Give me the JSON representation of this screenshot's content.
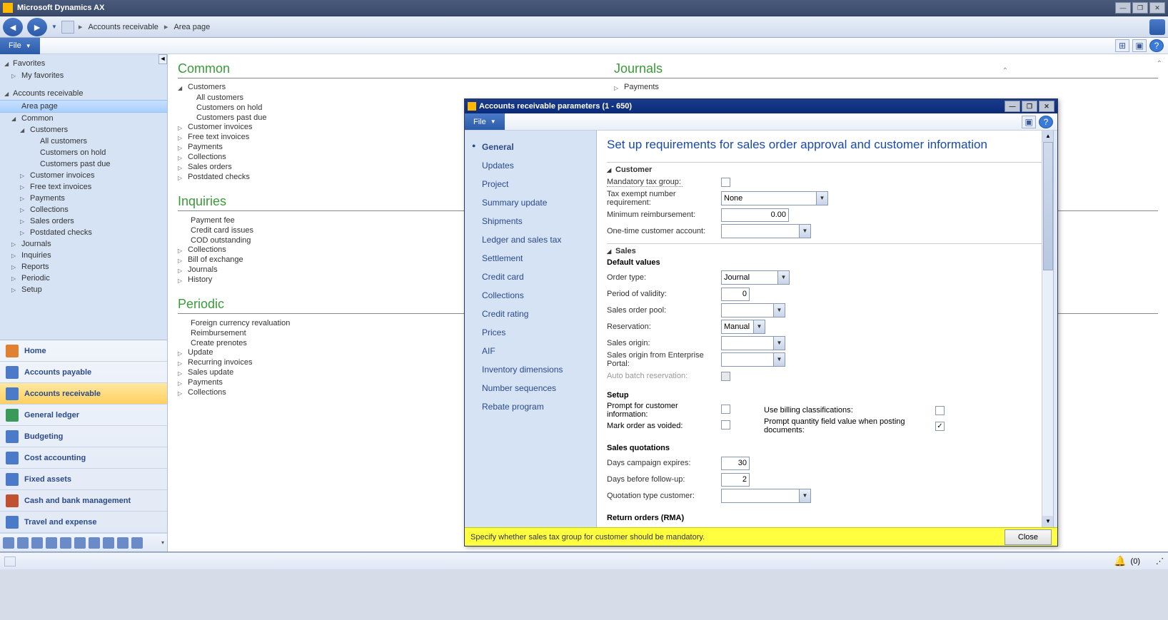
{
  "app": {
    "title": "Microsoft Dynamics AX"
  },
  "breadcrumb": {
    "item1": "Accounts receivable",
    "item2": "Area page"
  },
  "menubar": {
    "file": "File"
  },
  "leftnav": {
    "favorites": "Favorites",
    "myfav": "My favorites",
    "ar": "Accounts receivable",
    "areapage": "Area page",
    "common": "Common",
    "customers": "Customers",
    "allcust": "All customers",
    "custhold": "Customers on hold",
    "custpastdue": "Customers past due",
    "custinv": "Customer invoices",
    "freetext": "Free text invoices",
    "payments": "Payments",
    "collections": "Collections",
    "salesorders": "Sales orders",
    "postdated": "Postdated checks",
    "journals": "Journals",
    "inquiries": "Inquiries",
    "reports": "Reports",
    "periodic": "Periodic",
    "setup": "Setup"
  },
  "modules": {
    "home": "Home",
    "ap": "Accounts payable",
    "ar": "Accounts receivable",
    "gl": "General ledger",
    "budgeting": "Budgeting",
    "cost": "Cost accounting",
    "fixed": "Fixed assets",
    "cash": "Cash and bank management",
    "travel": "Travel and expense"
  },
  "area": {
    "common": {
      "title": "Common",
      "customers": "Customers",
      "allcust": "All customers",
      "custhold": "Customers on hold",
      "custpastdue": "Customers past due",
      "custinv": "Customer invoices",
      "freetext": "Free text invoices",
      "payments": "Payments",
      "collections": "Collections",
      "salesorders": "Sales orders",
      "postdated": "Postdated checks"
    },
    "inquiries": {
      "title": "Inquiries",
      "payfee": "Payment fee",
      "ccissues": "Credit card issues",
      "cod": "COD outstanding",
      "collections": "Collections",
      "boe": "Bill of exchange",
      "journals": "Journals",
      "history": "History"
    },
    "periodic": {
      "title": "Periodic",
      "fcr": "Foreign currency revaluation",
      "reimb": "Reimbursement",
      "prenotes": "Create prenotes",
      "update": "Update",
      "recurring": "Recurring invoices",
      "salesupdate": "Sales update",
      "payments": "Payments",
      "collections": "Collections"
    },
    "journals": {
      "title": "Journals",
      "payments": "Payments"
    }
  },
  "dialog": {
    "title": "Accounts receivable parameters (1 - 650)",
    "file": "File",
    "nav": {
      "general": "General",
      "updates": "Updates",
      "project": "Project",
      "summary": "Summary update",
      "shipments": "Shipments",
      "ledger": "Ledger and sales tax",
      "settlement": "Settlement",
      "creditcard": "Credit card",
      "collections": "Collections",
      "creditrating": "Credit rating",
      "prices": "Prices",
      "aif": "AIF",
      "invdim": "Inventory dimensions",
      "numseq": "Number sequences",
      "rebate": "Rebate program"
    },
    "heading": "Set up requirements for sales order approval and customer information",
    "customer": {
      "header": "Customer",
      "mandtax": "Mandatory tax group:",
      "taxexempt": "Tax exempt number requirement:",
      "taxexempt_value": "None",
      "minreimb": "Minimum reimbursement:",
      "minreimb_value": "0.00",
      "onetime": "One-time customer account:"
    },
    "sales": {
      "header": "Sales",
      "defvalues": "Default values",
      "ordertype": "Order type:",
      "ordertype_value": "Journal",
      "period": "Period of validity:",
      "period_value": "0",
      "pool": "Sales order pool:",
      "reservation": "Reservation:",
      "reservation_value": "Manual",
      "origin": "Sales origin:",
      "originep": "Sales origin from Enterprise Portal:",
      "autobatch": "Auto batch reservation:",
      "setup": "Setup",
      "prompt": "Prompt for customer information:",
      "usebilling": "Use billing classifications:",
      "markvoid": "Mark order as voided:",
      "promptqty": "Prompt quantity field value when posting documents:",
      "quotations": "Sales quotations",
      "campexp": "Days campaign expires:",
      "campexp_value": "30",
      "followup": "Days before follow-up:",
      "followup_value": "2",
      "quottype": "Quotation type customer:",
      "returnorders": "Return orders (RMA)"
    },
    "footer_msg": "Specify whether sales tax group for customer should be mandatory.",
    "close": "Close"
  },
  "status": {
    "count": "(0)"
  }
}
